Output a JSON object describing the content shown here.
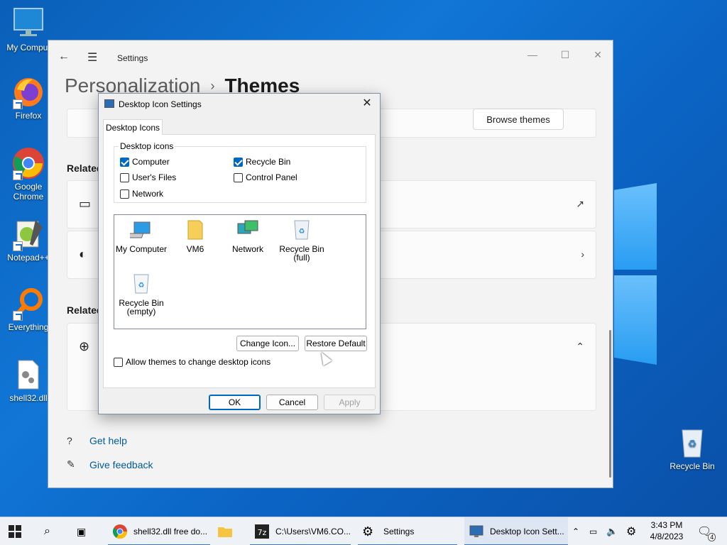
{
  "desktop": {
    "icons": [
      {
        "label": "My Comput"
      },
      {
        "label": "Firefox"
      },
      {
        "label": "Google Chrome"
      },
      {
        "label": "Notepad++"
      },
      {
        "label": "Everything"
      },
      {
        "label": "shell32.dll"
      },
      {
        "label": "Recycle Bin"
      }
    ]
  },
  "settings": {
    "title": "Settings",
    "breadcrumb_parent": "Personalization",
    "breadcrumb_separator": "›",
    "breadcrumb_current": "Themes",
    "browse_themes_label": "Browse themes",
    "related_label_1": "Related",
    "related_label_2": "Related",
    "get_help_label": "Get help",
    "give_feedback_label": "Give feedback"
  },
  "dialog": {
    "title": "Desktop Icon Settings",
    "tab_label": "Desktop Icons",
    "group_label": "Desktop icons",
    "checkboxes": [
      {
        "label": "Computer",
        "checked": true
      },
      {
        "label": "Recycle Bin",
        "checked": true
      },
      {
        "label": "User's Files",
        "checked": false
      },
      {
        "label": "Control Panel",
        "checked": false
      },
      {
        "label": "Network",
        "checked": false
      }
    ],
    "icon_items": [
      {
        "label": "My Computer"
      },
      {
        "label": "VM6"
      },
      {
        "label": "Network"
      },
      {
        "label": "Recycle Bin (full)"
      },
      {
        "label": "Recycle Bin (empty)"
      }
    ],
    "change_icon_label": "Change Icon...",
    "restore_default_label": "Restore Default",
    "allow_themes_label": "Allow themes to change desktop icons",
    "allow_themes_checked": false,
    "ok_label": "OK",
    "cancel_label": "Cancel",
    "apply_label": "Apply"
  },
  "taskbar": {
    "items": [
      {
        "label": "shell32.dll free do..."
      },
      {
        "label": "C:\\Users\\VM6.CO..."
      },
      {
        "label": "Settings"
      },
      {
        "label": "Desktop Icon Sett..."
      }
    ],
    "time": "3:43 PM",
    "date": "4/8/2023",
    "notification_count": "4"
  },
  "colors": {
    "accent": "#0067c0",
    "link": "#005a9e",
    "desktop": "#0b64c4"
  }
}
